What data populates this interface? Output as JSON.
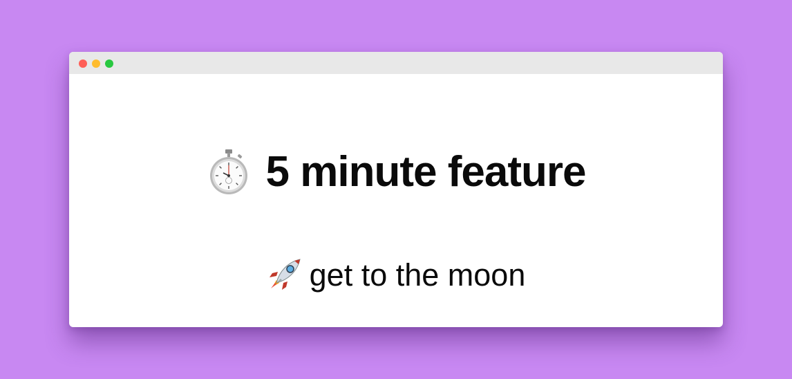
{
  "background_color": "#c888f2",
  "window": {
    "controls": [
      "close",
      "minimize",
      "zoom"
    ],
    "colors": {
      "close": "#ff5f57",
      "minimize": "#febc2e",
      "zoom": "#28c840",
      "titlebar": "#e8e8e8"
    }
  },
  "main": {
    "title_icon": "stopwatch-icon",
    "title": "5 minute feature",
    "subtitle_icon": "rocket-icon",
    "subtitle": "get to the moon"
  }
}
